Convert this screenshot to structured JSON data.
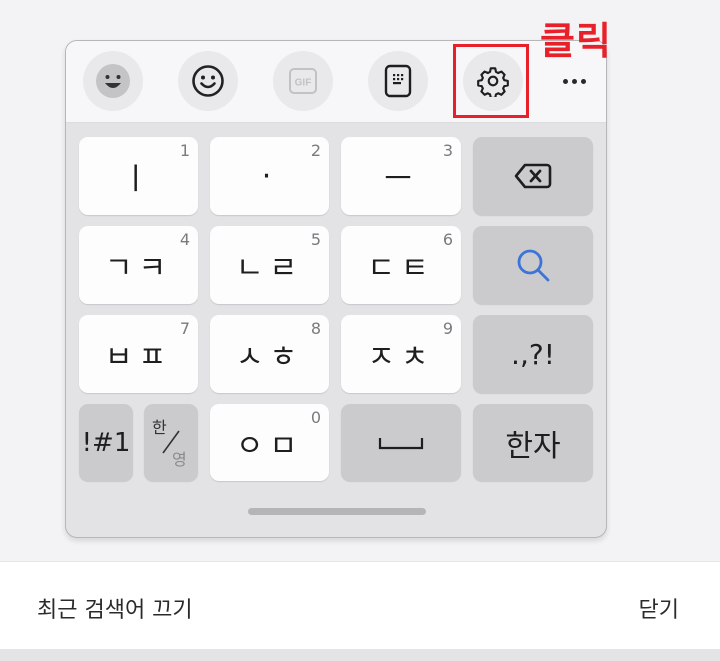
{
  "toolbar": {
    "buttons": [
      {
        "name": "emoji-sticker",
        "icon": "filled-smile-icon"
      },
      {
        "name": "emoji",
        "icon": "smile-outline-icon"
      },
      {
        "name": "gif",
        "icon": "gif-icon",
        "label": "GIF"
      },
      {
        "name": "keypad-mode",
        "icon": "keypad-icon"
      },
      {
        "name": "settings",
        "icon": "gear-icon"
      },
      {
        "name": "more",
        "icon": "more-dots-icon"
      }
    ]
  },
  "annotation": {
    "text": "클릭",
    "color": "#e8202a"
  },
  "keys": {
    "row1": [
      {
        "label": "ㅣ",
        "num": "1"
      },
      {
        "label": "·",
        "num": "2"
      },
      {
        "label": "ㅡ",
        "num": "3"
      },
      {
        "label": "",
        "icon": "backspace-icon"
      }
    ],
    "row2": [
      {
        "label": "ㄱㅋ",
        "num": "4"
      },
      {
        "label": "ㄴㄹ",
        "num": "5"
      },
      {
        "label": "ㄷㅌ",
        "num": "6"
      },
      {
        "label": "",
        "icon": "search-icon"
      }
    ],
    "row3": [
      {
        "label": "ㅂㅍ",
        "num": "7"
      },
      {
        "label": "ㅅㅎ",
        "num": "8"
      },
      {
        "label": "ㅈㅊ",
        "num": "9"
      },
      {
        "label": ".,?!"
      }
    ],
    "row4": [
      {
        "label": "!#1"
      },
      {
        "label_top": "한",
        "label_bottom": "영"
      },
      {
        "label": "ㅇㅁ",
        "num": "0"
      },
      {
        "label": "",
        "icon": "space-icon"
      },
      {
        "label": "한자"
      }
    ]
  },
  "bottom_bar": {
    "left": "최근 검색어 끄기",
    "right": "닫기"
  },
  "colors": {
    "accent_search": "#3d74d8"
  }
}
